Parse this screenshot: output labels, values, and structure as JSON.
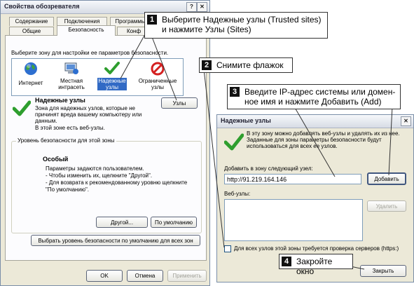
{
  "main_dialog": {
    "title": "Свойства обозревателя",
    "help": "?",
    "close": "✕",
    "tabs_row1": [
      "Содержание",
      "Подключения",
      "Программы"
    ],
    "tabs_row2": [
      "Общие",
      "Безопасность",
      "Конф"
    ],
    "zone_prompt": "Выберите зону для настройки ее параметров безопасности.",
    "zones": [
      {
        "label": "Интернет"
      },
      {
        "label": "Местная интрасеть"
      },
      {
        "label": "Надежные узлы"
      },
      {
        "label": "Ограниченные узлы"
      }
    ],
    "zone_title": "Надежные узлы",
    "zone_desc": [
      "Зона для надежных узлов, которые не",
      "причинят вреда вашему компьютеру или",
      "данным.",
      "В этой зоне есть веб-узлы."
    ],
    "sites_button": "Узлы",
    "security_group": "Уровень безопасности для этой зоны",
    "level_title": "Особый",
    "level_desc": [
      "Параметры задаются пользователем.",
      "- Чтобы изменить их, щелкните \"Другой\".",
      "- Для возврата к рекомендованному уровню щелкните",
      "\"По умолчанию\"."
    ],
    "custom_button": "Другой...",
    "default_button": "По умолчанию",
    "default_all_button": "Выбрать уровень безопасности по умолчанию для всех зон",
    "ok_button": "OK",
    "cancel_button": "Отмена",
    "apply_button": "Применить"
  },
  "sites_dialog": {
    "title": "Надежные узлы",
    "close": "✕",
    "info": [
      "В эту зону можно добавлять веб-узлы и удалять их из нее.",
      "Заданные для зоны параметры безопасности будут",
      "использоваться для всех ее узлов."
    ],
    "add_label": "Добавить в зону следующий узел:",
    "add_value": "http://91.219.164.146",
    "add_button": "Добавить",
    "sites_label": "Веб-узлы:",
    "remove_button": "Удалить",
    "checkbox_label": "Для всех узлов этой зоны требуется проверка серверов (https:)",
    "close_button": "Закрыть"
  },
  "callouts": [
    {
      "num": "1",
      "lines": [
        "Выберите Надежные узлы (Trusted sites)",
        "и нажмите Узлы (Sites)"
      ]
    },
    {
      "num": "2",
      "lines": [
        "Снимите флажок"
      ]
    },
    {
      "num": "3",
      "lines": [
        "Введите IP-адрес системы или домен-",
        "ное имя и нажмите Добавить (Add)"
      ]
    },
    {
      "num": "4",
      "lines": [
        "Закройте окно"
      ]
    }
  ],
  "colors": {
    "dialog_bg": "#ece9d8",
    "panel_bg": "#fcfcfe",
    "check_green": "#2e9e2e",
    "selected": "#316ac5",
    "globe_blue": "#2d6fd0",
    "restricted_red": "#d42020"
  },
  "icons": [
    "globe-icon",
    "intranet-computer-icon",
    "trusted-check-icon",
    "restricted-icon",
    "checkmark-icon"
  ]
}
